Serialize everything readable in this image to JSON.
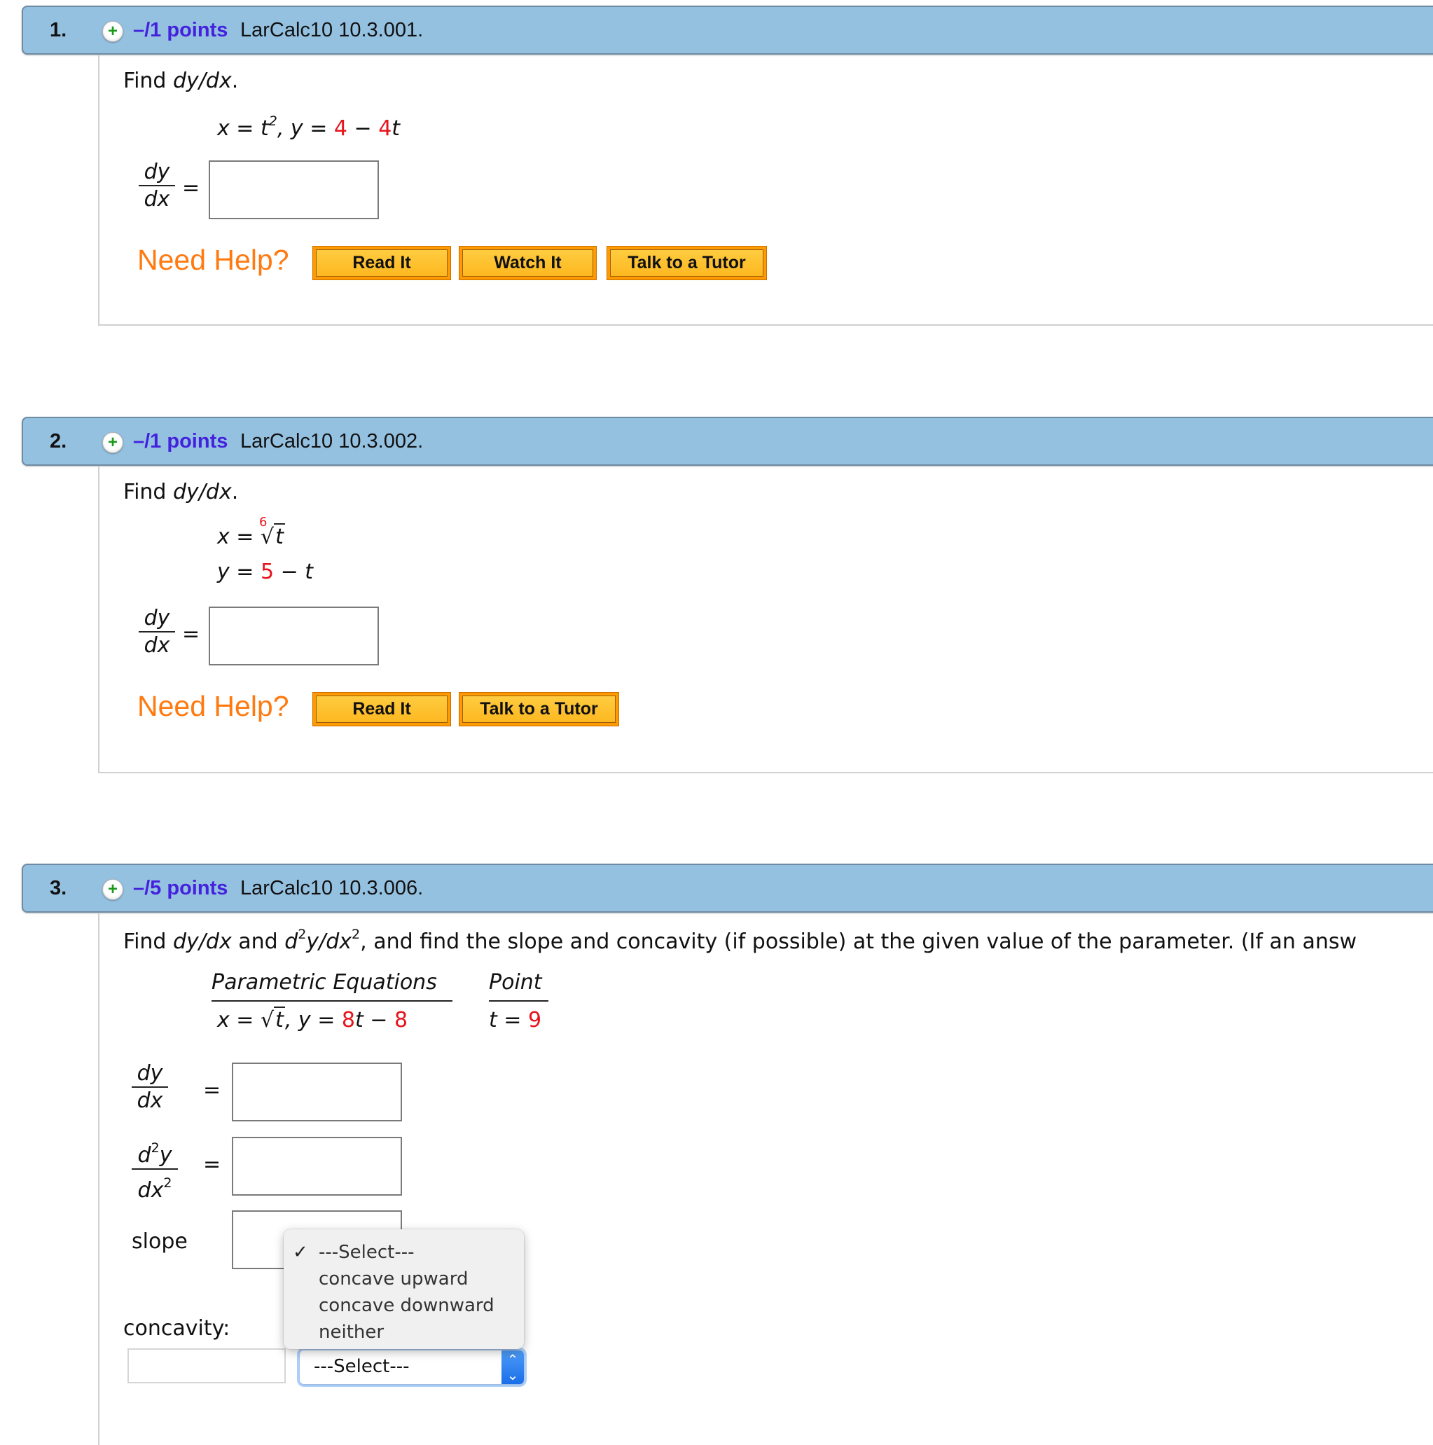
{
  "questions": [
    {
      "number": "1.",
      "points": "–/1 points",
      "id": "LarCalc10 10.3.001.",
      "prompt_find": "Find ",
      "prompt_expr": "dy/dx",
      "prompt_end": ".",
      "equation": {
        "x_lhs": "x = t",
        "x_exp": "2",
        "sep": ",  y = ",
        "c1": "4",
        "minus": " − ",
        "c2": "4",
        "var": "t"
      },
      "answer_label": {
        "num": "dy",
        "den": "dx",
        "eq": "="
      },
      "answer_value": "",
      "need_help": "Need Help?",
      "buttons": [
        "Read It",
        "Watch It",
        "Talk to a Tutor"
      ]
    },
    {
      "number": "2.",
      "points": "–/1 points",
      "id": "LarCalc10 10.3.002.",
      "prompt_find": "Find ",
      "prompt_expr": "dy/dx",
      "prompt_end": ".",
      "equation": {
        "x_lhs": "x = ",
        "root_index": "6",
        "root_arg": "t",
        "y_lhs": "y = ",
        "c1": "5",
        "minus": " − ",
        "var": "t"
      },
      "answer_label": {
        "num": "dy",
        "den": "dx",
        "eq": "="
      },
      "answer_value": "",
      "need_help": "Need Help?",
      "buttons": [
        "Read It",
        "Talk to a Tutor"
      ]
    },
    {
      "number": "3.",
      "points": "–/5 points",
      "id": "LarCalc10 10.3.006.",
      "prompt_parts": {
        "find": "Find ",
        "expr1": "dy/dx",
        "and": " and ",
        "d": "d",
        "exp": "2",
        "mid": "y/dx",
        "rest": ",  and find the slope and concavity (if possible) at the given value of the parameter. (If an answ"
      },
      "table": {
        "col1_header": "Parametric Equations",
        "col2_header": "Point",
        "x_lhs": "x = ",
        "root_arg": "t",
        "y_part": ",  y = ",
        "c1": "8",
        "var": "t",
        "minus": " − ",
        "c2": "8",
        "point_lhs": "t = ",
        "point_val": "9"
      },
      "fields": {
        "dydx": {
          "num": "dy",
          "den": "dx",
          "eq": "=",
          "value": ""
        },
        "d2ydx2": {
          "num_d": "d",
          "num_exp": "2",
          "num_y": "y",
          "den_dx": "dx",
          "den_exp": "2",
          "eq": "=",
          "value": ""
        },
        "slope": {
          "label": "slope",
          "value": ""
        },
        "concavity": {
          "label": "concavity:",
          "value": ""
        }
      },
      "concavity_select": {
        "selected": "---Select---",
        "options": [
          "---Select---",
          "concave upward",
          "concave downward",
          "neither"
        ],
        "checked_index": 0
      }
    }
  ],
  "colors": {
    "header_bg": "#95c1e1",
    "points_color": "#4422dd",
    "need_help_color": "#ff7a10",
    "button_orange": "#ff9b00",
    "value_red": "#e8141c"
  }
}
